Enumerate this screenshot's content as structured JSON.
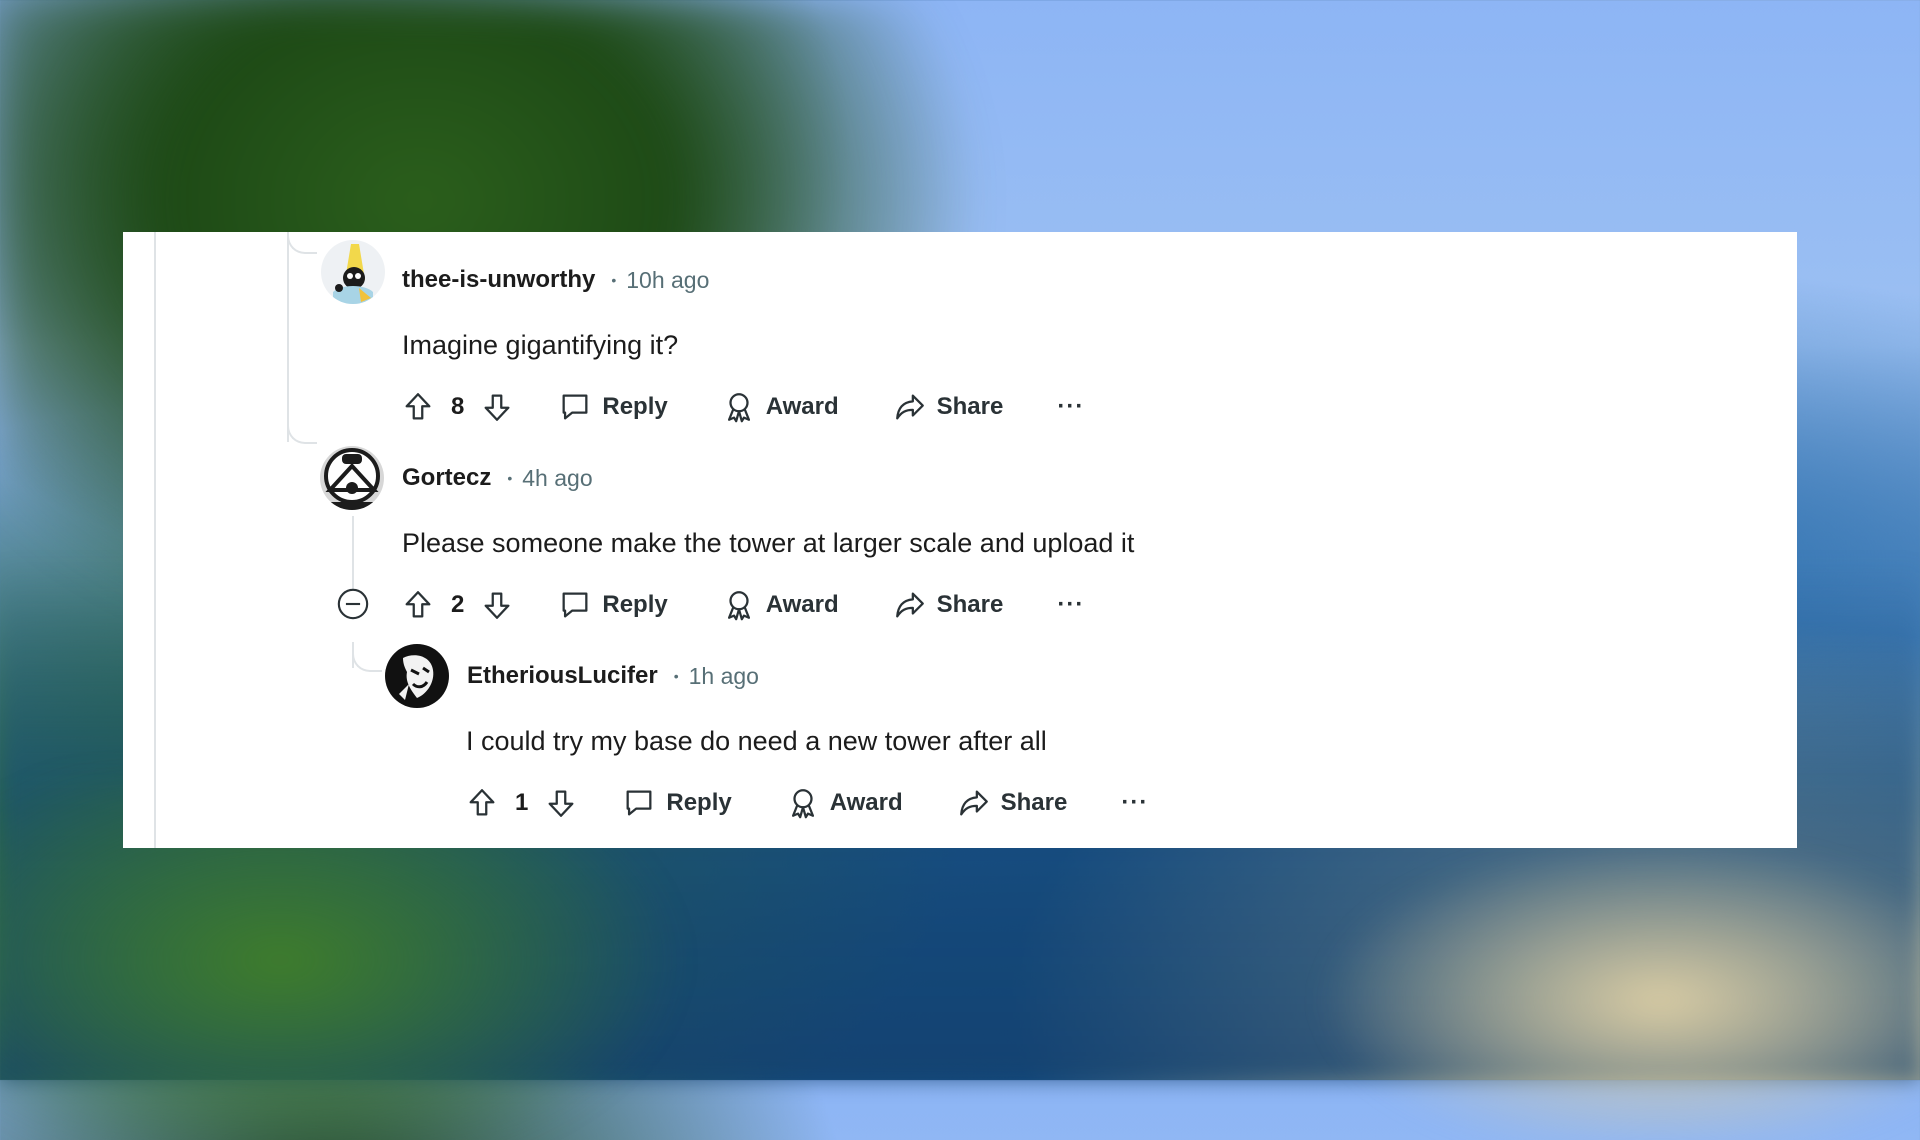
{
  "comments": [
    {
      "author": "thee-is-unworthy",
      "time": "10h ago",
      "body": "Imagine gigantifying it?",
      "votes": "8",
      "reply_label": "Reply",
      "award_label": "Award",
      "share_label": "Share",
      "more_label": "···"
    },
    {
      "author": "Gortecz",
      "time": "4h ago",
      "body": "Please someone make the tower at larger scale and upload it",
      "votes": "2",
      "reply_label": "Reply",
      "award_label": "Award",
      "share_label": "Share",
      "more_label": "···"
    },
    {
      "author": "EtheriousLucifer",
      "time": "1h ago",
      "body": "I could try my base do need a new tower after all",
      "votes": "1",
      "reply_label": "Reply",
      "award_label": "Award",
      "share_label": "Share",
      "more_label": "···"
    }
  ],
  "separator": "•",
  "icons": [
    "upvote-icon",
    "downvote-icon",
    "comment-icon",
    "award-icon",
    "share-icon",
    "collapse-icon"
  ],
  "colors": {
    "text": "#1c1c1c",
    "meta": "#576f76",
    "thread": "#dfe3e6",
    "card": "#ffffff"
  }
}
